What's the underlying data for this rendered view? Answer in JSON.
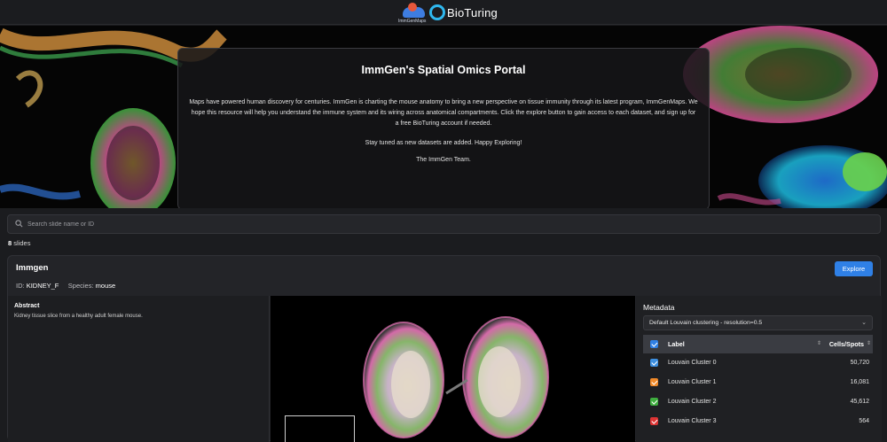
{
  "header": {
    "immgen_logo_caption": "ImmGenMaps",
    "bioturing_logo_text": "BioTuring"
  },
  "hero": {
    "title": "ImmGen's Spatial Omics Portal",
    "body": "Maps have powered human discovery for centuries. ImmGen is charting the mouse anatomy to bring a new perspective on tissue immunity through its latest program, ImmGenMaps. We hope this resource will help you understand the immune system and its wiring across anatomical compartments. Click the explore button to gain access to each dataset, and sign up for a free BioTuring account if needed.",
    "p2": "Stay tuned as new datasets are added. Happy Exploring!",
    "p3": "The ImmGen Team."
  },
  "search": {
    "placeholder": "Search slide name or ID"
  },
  "slides": {
    "count": "8",
    "label": "slides"
  },
  "card": {
    "title": "Immgen",
    "id_label": "ID:",
    "id_value": "KIDNEY_F",
    "species_label": "Species:",
    "species_value": "mouse",
    "explore_label": "Explore",
    "abstract_header": "Abstract",
    "abstract_text": "Kidney tissue slice from a healthy adult female mouse."
  },
  "metadata": {
    "header": "Metadata",
    "selected": "Default Louvain clustering - resolution=0.5",
    "col_label": "Label",
    "col_count": "Cells/Spots",
    "rows": [
      {
        "label": "Louvain Cluster 0",
        "count": "50,720",
        "color": "#3d8fe0"
      },
      {
        "label": "Louvain Cluster 1",
        "count": "16,081",
        "color": "#f08a2a"
      },
      {
        "label": "Louvain Cluster 2",
        "count": "45,612",
        "color": "#3fae3f"
      },
      {
        "label": "Louvain Cluster 3",
        "count": "564",
        "color": "#dd3434"
      }
    ]
  }
}
